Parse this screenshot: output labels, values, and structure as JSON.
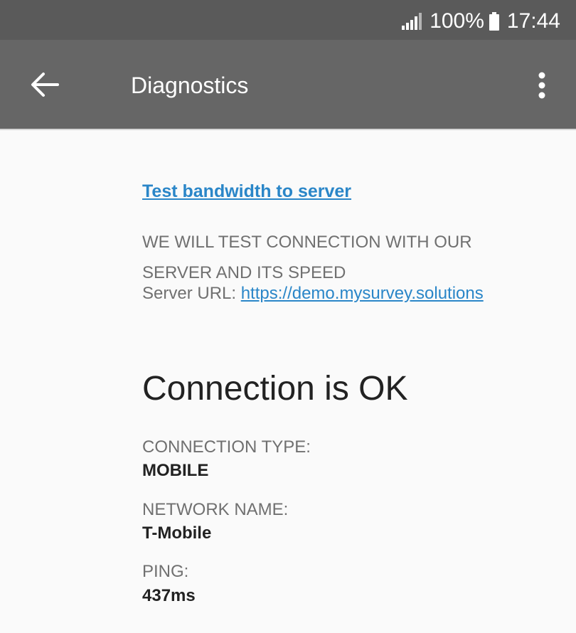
{
  "status_bar": {
    "battery_percent": "100%",
    "time": "17:44",
    "icons": [
      "signal-icon",
      "battery-icon"
    ]
  },
  "app_bar": {
    "title": "Diagnostics",
    "icons": [
      "back-arrow-icon",
      "more-vert-icon"
    ]
  },
  "bandwidth": {
    "link_label": "Test bandwidth to server",
    "description": "WE WILL TEST CONNECTION WITH OUR SERVER AND ITS SPEED",
    "server_label": "Server URL: ",
    "server_url": "https://demo.mysurvey.solutions"
  },
  "result": {
    "heading": "Connection is OK",
    "connection_type_label": "CONNECTION TYPE:",
    "connection_type_value": "MOBILE",
    "network_name_label": "NETWORK NAME:",
    "network_name_value": "T-Mobile",
    "ping_label": "PING:",
    "ping_value": "437ms"
  },
  "colors": {
    "status_bar": "#5a5a5a",
    "app_bar": "#666666",
    "link": "#2a86c8",
    "background": "#fafafa"
  }
}
